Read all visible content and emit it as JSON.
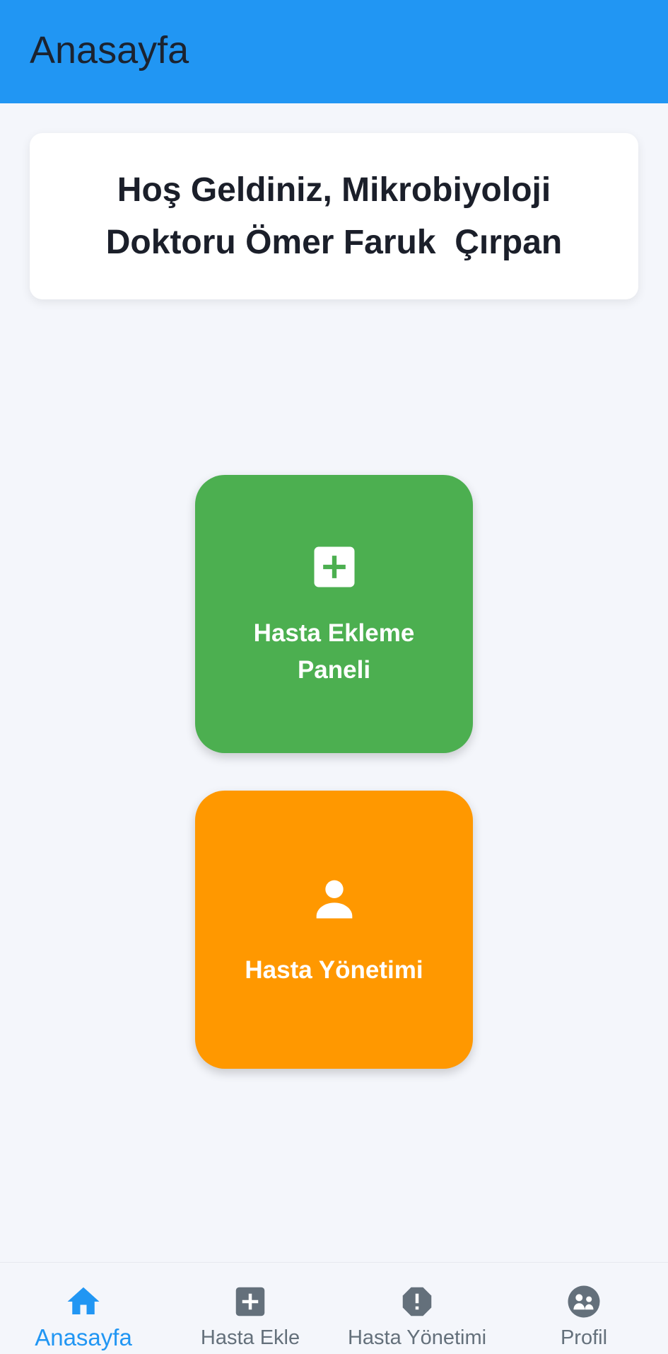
{
  "appbar": {
    "title": "Anasayfa",
    "color": "#2196f3"
  },
  "welcome": {
    "text": "Hoş Geldiniz, Mikrobiyoloji Doktoru Ömer Faruk  Çırpan"
  },
  "tiles": [
    {
      "label": "Hasta Ekleme Paneli",
      "icon": "add-box-icon",
      "color": "#4caf50"
    },
    {
      "label": "Hasta Yönetimi",
      "icon": "person-icon",
      "color": "#ff9800"
    }
  ],
  "bottom_nav": {
    "items": [
      {
        "label": "Anasayfa",
        "icon": "home-icon",
        "active": true
      },
      {
        "label": "Hasta Ekle",
        "icon": "add-box-icon",
        "active": false
      },
      {
        "label": "Hasta Yönetimi",
        "icon": "alert-icon",
        "active": false
      },
      {
        "label": "Profil",
        "icon": "people-icon",
        "active": false
      }
    ],
    "active_color": "#2196f3",
    "inactive_color": "#64707b"
  }
}
